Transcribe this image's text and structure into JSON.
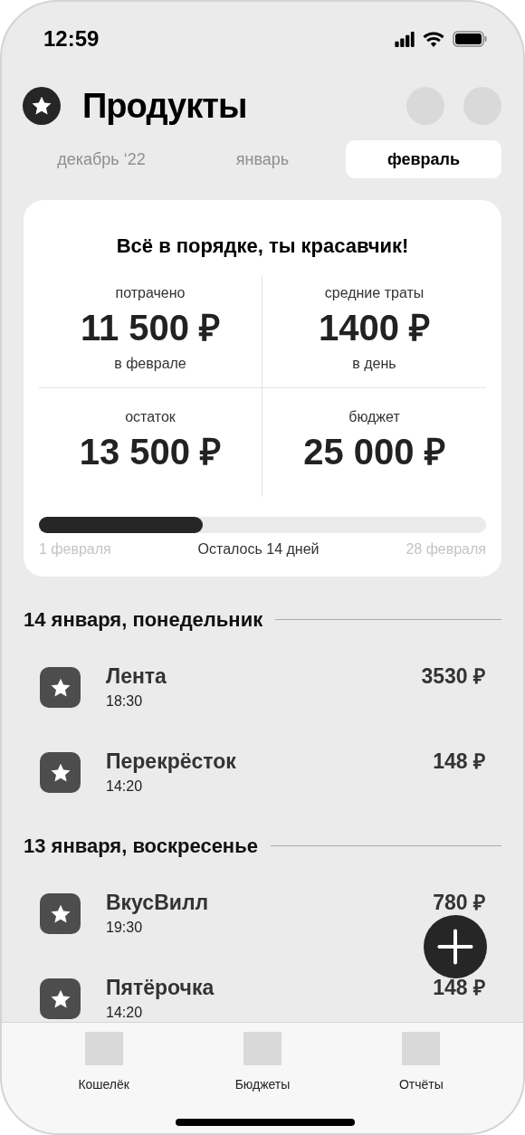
{
  "status_bar": {
    "time": "12:59"
  },
  "header": {
    "title": "Продукты"
  },
  "month_tabs": [
    {
      "label": "декабрь ‘22",
      "selected": false
    },
    {
      "label": "январь",
      "selected": false
    },
    {
      "label": "февраль",
      "selected": true
    }
  ],
  "summary": {
    "message": "Всё в порядке, ты красавчик!",
    "stats": [
      {
        "label": "потрачено",
        "value": "11 500 ₽",
        "note": "в феврале"
      },
      {
        "label": "средние траты",
        "value": "1400 ₽",
        "note": "в день"
      },
      {
        "label": "остаток",
        "value": "13 500 ₽"
      },
      {
        "label": "бюджет",
        "value": "25 000 ₽"
      }
    ],
    "progress": {
      "level": 0.366,
      "start": "1 февраля",
      "remaining": "Осталось 14 дней",
      "end": "28 февраля"
    }
  },
  "days": [
    {
      "date": "14 января, понедельник",
      "items": [
        {
          "name": "Лента",
          "time": "18:30",
          "amount": "3530 ₽"
        },
        {
          "name": "Перекрёсток",
          "time": "14:20",
          "amount": "148 ₽"
        }
      ]
    },
    {
      "date": "13 января, воскресенье",
      "items": [
        {
          "name": "ВкусВилл",
          "time": "19:30",
          "amount": "780 ₽"
        },
        {
          "name": "Пятёрочка",
          "time": "14:20",
          "amount": "148 ₽"
        }
      ]
    }
  ],
  "tab_bar": [
    {
      "label": "Кошелёк"
    },
    {
      "label": "Бюджеты"
    },
    {
      "label": "Отчёты"
    }
  ]
}
